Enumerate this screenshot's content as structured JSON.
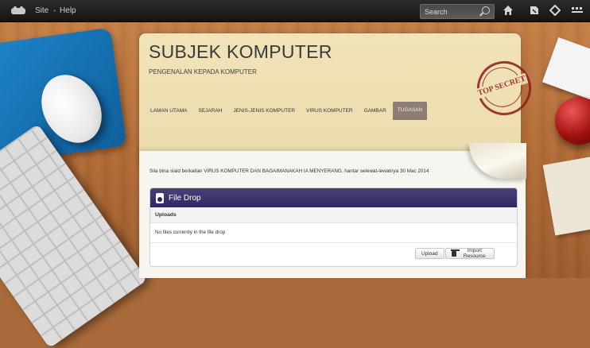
{
  "topbar": {
    "site_label": "Site",
    "separator": "•",
    "help_label": "Help",
    "search_placeholder": "Search",
    "icons": [
      "home-icon",
      "tools-icon",
      "share-icon",
      "apps-icon"
    ]
  },
  "page": {
    "title": "SUBJEK KOMPUTER",
    "subtitle": "PENGENALAN KEPADA KOMPUTER",
    "stamp_text": "TOP SECRET",
    "tabs": [
      {
        "label": "LAMAN UTAMA",
        "active": false
      },
      {
        "label": "SEJARAH",
        "active": false
      },
      {
        "label": "JENIS-JENIS KOMPUTER",
        "active": false
      },
      {
        "label": "VIRUS KOMPUTER",
        "active": false
      },
      {
        "label": "GAMBAR",
        "active": false
      },
      {
        "label": "TUGASAN",
        "active": true
      }
    ],
    "notice": "Sila bina slaid berkaitan VIRUS KOMPUTER DAN BAGAIMANAKAH IA MENYERANG, hantar selewat-lewatnya 30 Mac 2014"
  },
  "filedrop": {
    "title": "File Drop",
    "section_label": "Uploads",
    "empty_message": "No files currently in the file drop",
    "upload_label": "Upload",
    "import_label": "Import Resource"
  },
  "colors": {
    "topbar": "#1c1c1c",
    "folder": "#efe0b3",
    "active_tab": "#8d7d75",
    "filedrop_header": "#3b3470",
    "stamp": "#8d1b1b"
  }
}
